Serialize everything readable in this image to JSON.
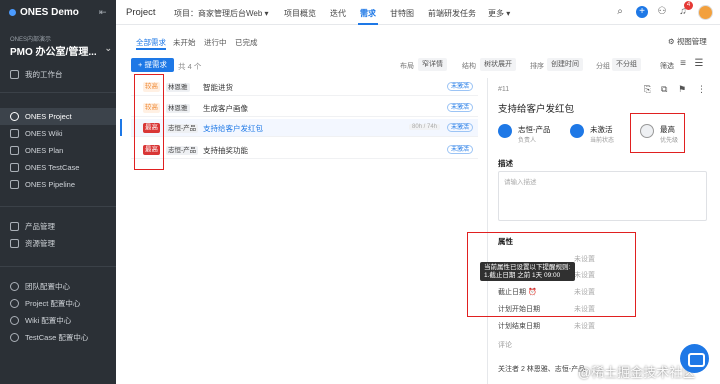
{
  "app": {
    "brand": "ONES Demo",
    "org": "ONES内部演示",
    "project": "PMO 办公室/管理..."
  },
  "sidebar": {
    "items": [
      {
        "label": "我的工作台"
      },
      {
        "label": "ONES Project"
      },
      {
        "label": "ONES Wiki"
      },
      {
        "label": "ONES Plan"
      },
      {
        "label": "ONES TestCase"
      },
      {
        "label": "ONES Pipeline"
      },
      {
        "label": "产品管理"
      },
      {
        "label": "资源管理"
      },
      {
        "label": "团队配置中心"
      },
      {
        "label": "Project 配置中心"
      },
      {
        "label": "Wiki 配置中心"
      },
      {
        "label": "TestCase 配置中心"
      }
    ]
  },
  "topbar": {
    "title": "Project",
    "tabs": [
      "项目：商家管理后台Web ▾",
      "项目概览",
      "迭代",
      "需求",
      "甘特图",
      "前端研发任务",
      "更多 ▾"
    ],
    "notif_count": "4"
  },
  "subtabs": [
    "全部需求",
    "未开始",
    "进行中",
    "已完成"
  ],
  "view_manage": "视图管理",
  "toolbar": {
    "new_label": "+ 提需求",
    "count": "共 4 个",
    "layout_label": "布局",
    "layout_value": "窄详情",
    "structure_label": "结构",
    "structure_value": "树状展开",
    "sort_label": "排序",
    "sort_value": "创建时间",
    "group_label": "分组",
    "group_value": "不分组",
    "filter_label": "筛选"
  },
  "rows": [
    {
      "priority": "较高",
      "assignee": "林恩雅",
      "title": "智能进货",
      "time": "",
      "status": "未激活"
    },
    {
      "priority": "较高",
      "assignee": "林恩雅",
      "title": "生成客户画像",
      "time": "",
      "status": "未激活"
    },
    {
      "priority": "最高",
      "assignee": "志恒-产品",
      "title": "支持给客户发红包",
      "time": "80h / 74h",
      "status": "未激活"
    },
    {
      "priority": "最高",
      "assignee": "志恒-产品",
      "title": "支持抽奖功能",
      "time": "",
      "status": "未激活"
    }
  ],
  "detail": {
    "id": "#11",
    "title": "支持给客户发红包",
    "owner_value": "志恒-产品",
    "owner_key": "负责人",
    "status_value": "未激活",
    "status_key": "当前状态",
    "priority_value": "最高",
    "priority_key": "优先级",
    "desc_label": "描述",
    "desc_placeholder": "请输入描述",
    "attr_label": "属性",
    "attrs": [
      {
        "k": "",
        "v": "未设置"
      },
      {
        "k": "",
        "v": "未设置"
      },
      {
        "k": "截止日期 ⏰",
        "v": "未设置"
      },
      {
        "k": "计划开始日期",
        "v": "未设置"
      },
      {
        "k": "计划结束日期",
        "v": "未设置"
      }
    ],
    "tooltip": "当前属性已设置以下提醒规则:\n1.截止日期 之前 1天 09:00",
    "comment": "评论",
    "followers": "关注者 2 林恩雅、志恒-产品",
    "watermark": "@稀土掘金技术社区"
  },
  "colors": {
    "accent": "#1e78e6",
    "sidebar_bg": "#2b3036",
    "high_prio": "#d93636",
    "mid_prio": "#f08c38",
    "highlight": "#e02020"
  }
}
